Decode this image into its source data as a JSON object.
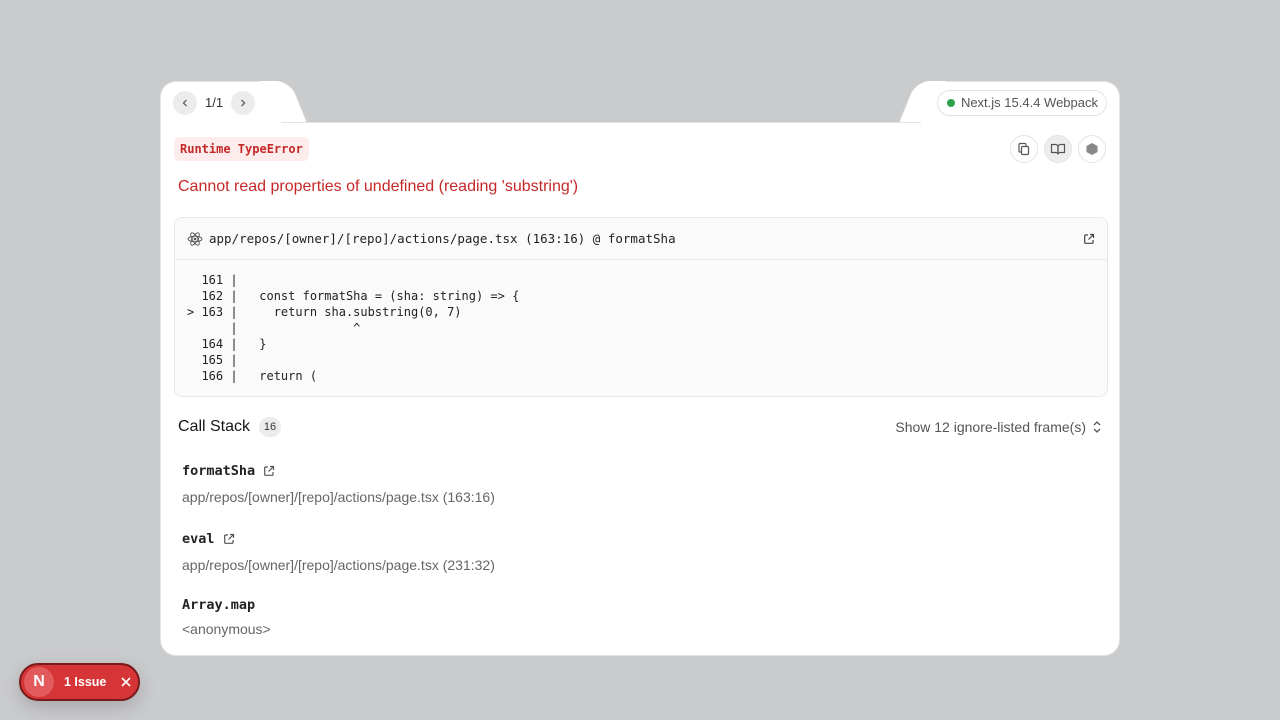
{
  "pager": {
    "prev_icon": "chevron-left-icon",
    "next_icon": "chevron-right-icon",
    "count": "1/1"
  },
  "version": {
    "label": "Next.js 15.4.4 Webpack",
    "status_color": "#2fa34a"
  },
  "error": {
    "type_label": "Runtime TypeError",
    "message": "Cannot read properties of undefined (reading 'substring')",
    "color": "#c62828"
  },
  "toolbar": {
    "copy_icon": "copy-icon",
    "docs_icon": "book-open-icon",
    "nodejs_icon": "nodejs-icon"
  },
  "code_frame": {
    "file": "app/repos/[owner]/[repo]/actions/page.tsx (163:16) @ formatSha",
    "lines": [
      "  161 |",
      "  162 |   const formatSha = (sha: string) => {",
      "> 163 |     return sha.substring(0, 7)",
      "      |                ^",
      "  164 |   }",
      "  165 |",
      "  166 |   return ("
    ]
  },
  "call_stack": {
    "title": "Call Stack",
    "count": "16",
    "toggle_label": "Show 12 ignore-listed frame(s)",
    "frames": [
      {
        "fn": "formatSha",
        "location": "app/repos/[owner]/[repo]/actions/page.tsx (163:16)"
      },
      {
        "fn": "eval",
        "location": "app/repos/[owner]/[repo]/actions/page.tsx (231:32)"
      },
      {
        "fn": "Array.map",
        "location": "<anonymous>"
      }
    ]
  },
  "issue_badge": {
    "logo": "N",
    "label": "1 Issue",
    "close_icon": "close-icon",
    "color": "#d63537"
  }
}
